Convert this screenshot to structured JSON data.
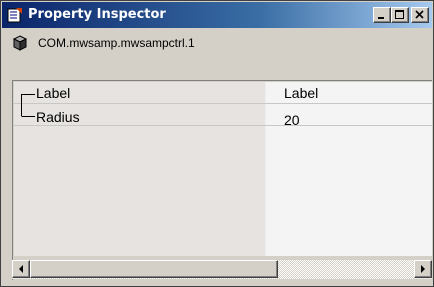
{
  "window": {
    "title": "Property Inspector",
    "controls": {
      "minimize": "minimize-icon",
      "maximize": "maximize-icon",
      "close": "close-icon"
    }
  },
  "object": {
    "icon": "cube-icon",
    "name": "COM.mwsamp.mwsampctrl.1"
  },
  "properties": [
    {
      "name": "Label",
      "value": "Label"
    },
    {
      "name": "Radius",
      "value": "20"
    }
  ],
  "colors": {
    "titlebar_start": "#0a246a",
    "titlebar_end": "#a6caf0",
    "face": "#d4d0c8"
  }
}
